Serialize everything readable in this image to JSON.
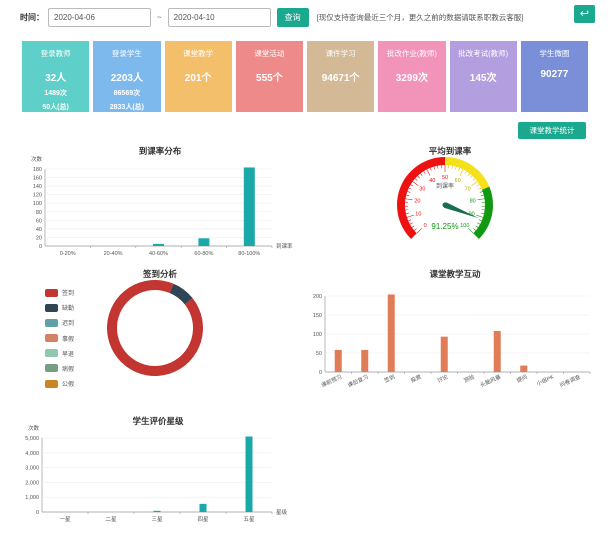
{
  "filter": {
    "label": "时间：",
    "start_date": "2020-04-06",
    "separator": "~",
    "end_date": "2020-04-10",
    "query_label": "查询",
    "notice": "[现仅支持查询最近三个月，更久之前的数据请联系职教云客服]"
  },
  "back_icon": "↩",
  "cards": [
    {
      "title": "登录教师",
      "value": "32人",
      "sub1": "1489次",
      "sub2": "50人(总)",
      "color": "#5fcfc9"
    },
    {
      "title": "登录学生",
      "value": "2203人",
      "sub1": "86569次",
      "sub2": "2833人(总)",
      "color": "#7eb9ee"
    },
    {
      "title": "课堂教学",
      "value": "201个",
      "sub1": "",
      "sub2": "",
      "color": "#f4bf6b"
    },
    {
      "title": "课堂活动",
      "value": "555个",
      "sub1": "",
      "sub2": "",
      "color": "#ef8a8a"
    },
    {
      "title": "课件学习",
      "value": "94671个",
      "sub1": "",
      "sub2": "",
      "color": "#d3b995"
    },
    {
      "title": "批改作业(教师)",
      "value": "3299次",
      "sub1": "",
      "sub2": "",
      "color": "#f293ba"
    },
    {
      "title": "批改考试(教师)",
      "value": "145次",
      "sub1": "",
      "sub2": "",
      "color": "#b39ee0"
    },
    {
      "title": "学生微圈",
      "value": "90277",
      "sub1": "",
      "sub2": "",
      "color": "#7a8fd8"
    }
  ],
  "stat_button": "课堂教学统计",
  "chart_data": [
    {
      "type": "bar",
      "title": "到课率分布",
      "ylabel": "次数",
      "xlabel": "到课率",
      "categories": [
        "0-20%",
        "20-40%",
        "40-60%",
        "60-80%",
        "80-100%"
      ],
      "values": [
        0,
        0,
        5,
        18,
        184
      ],
      "ylim": [
        0,
        180
      ],
      "yticks": [
        0,
        20,
        40,
        60,
        80,
        100,
        120,
        140,
        160,
        180
      ],
      "color": "#1aa8a8"
    },
    {
      "type": "gauge",
      "title": "平均到课率",
      "label": "到课率",
      "value": 91.25,
      "value_text": "91.25%",
      "ticks": [
        0,
        10,
        20,
        30,
        40,
        50,
        60,
        70,
        80,
        90,
        100
      ]
    },
    {
      "type": "pie",
      "title": "签到分析",
      "legend": [
        "签到",
        "缺勤",
        "迟到",
        "事假",
        "早退",
        "病假",
        "公假"
      ],
      "colors": [
        "#c23531",
        "#2f4554",
        "#61a0a8",
        "#d48265",
        "#91c7ae",
        "#749f83",
        "#ca8622"
      ],
      "values": [
        92,
        8,
        0,
        0,
        0,
        0,
        0
      ]
    },
    {
      "type": "bar",
      "title": "课堂教学互动",
      "categories": [
        "课前预习",
        "课后复习",
        "签到",
        "投票",
        "讨论",
        "测验",
        "头脑风暴",
        "提问",
        "小组PK",
        "问卷调查"
      ],
      "values": [
        58,
        58,
        212,
        0,
        93,
        0,
        108,
        17,
        0,
        0
      ],
      "ylim": [
        0,
        200
      ],
      "yticks": [
        0,
        50,
        100,
        150,
        200
      ],
      "color": "#e07c58"
    },
    {
      "type": "bar",
      "title": "学生评价星级",
      "ylabel": "次数",
      "xlabel": "星级",
      "categories": [
        "一星",
        "二星",
        "三星",
        "四星",
        "五星"
      ],
      "values": [
        0,
        0,
        80,
        550,
        5200
      ],
      "ylim": [
        0,
        5000
      ],
      "yticks": [
        "0",
        "1,000",
        "2,000",
        "3,000",
        "4,000",
        "5,000"
      ],
      "color": "#1aa8a8"
    }
  ]
}
